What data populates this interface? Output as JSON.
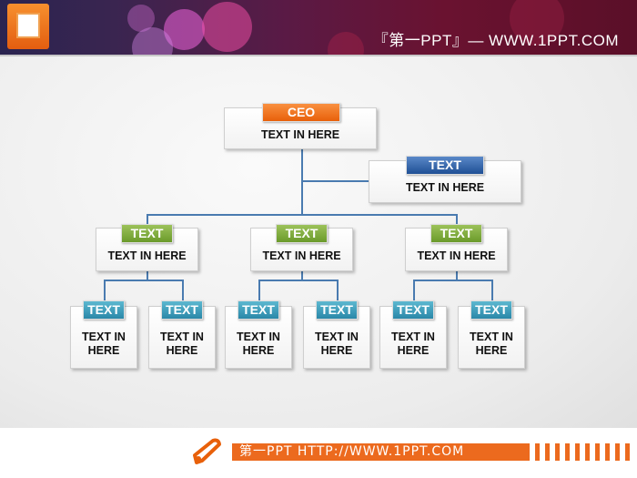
{
  "header": {
    "site_text": "『第一PPT』— WWW.1PPT.COM",
    "logo_icon": "powerpoint-icon"
  },
  "org_chart": {
    "ceo": {
      "label": "CEO",
      "text": "TEXT IN HERE"
    },
    "assistant": {
      "label": "TEXT",
      "text": "TEXT IN HERE"
    },
    "level2": [
      {
        "label": "TEXT",
        "text": "TEXT IN HERE",
        "children": [
          {
            "label": "TEXT",
            "text": "TEXT IN HERE"
          },
          {
            "label": "TEXT",
            "text": "TEXT IN HERE"
          }
        ]
      },
      {
        "label": "TEXT",
        "text": "TEXT IN HERE",
        "children": [
          {
            "label": "TEXT",
            "text": "TEXT IN HERE"
          },
          {
            "label": "TEXT",
            "text": "TEXT IN HERE"
          }
        ]
      },
      {
        "label": "TEXT",
        "text": "TEXT IN HERE",
        "children": [
          {
            "label": "TEXT",
            "text": "TEXT IN HERE"
          },
          {
            "label": "TEXT",
            "text": "TEXT IN HERE"
          }
        ]
      }
    ]
  },
  "colors": {
    "ceo": "#e8600a",
    "assistant": "#1f4f95",
    "level2": "#6a9a2a",
    "level3": "#2a87a8",
    "lines": "#4a7bb0",
    "footer": "#ec6a1e"
  },
  "footer": {
    "text": "第一PPT HTTP://WWW.1PPT.COM",
    "icon": "pencil-icon"
  }
}
